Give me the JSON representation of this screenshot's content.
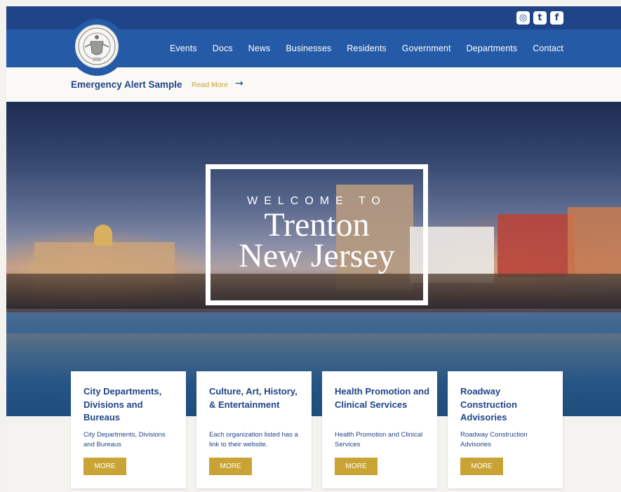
{
  "social": {
    "icons": [
      "instagram-icon",
      "twitter-icon",
      "facebook-icon"
    ],
    "glyphs": [
      "◎",
      "t",
      "f"
    ]
  },
  "nav": {
    "items": [
      "Events",
      "Docs",
      "News",
      "Businesses",
      "Residents",
      "Government",
      "Departments",
      "Contact"
    ]
  },
  "alert": {
    "title": "Emergency Alert Sample",
    "read_more": "Read More",
    "arrow": "→"
  },
  "hero": {
    "welcome": "WELCOME TO",
    "city_line1": "Trenton",
    "city_line2": "New Jersey"
  },
  "cards": [
    {
      "title": "City Departments, Divisions and Bureaus",
      "desc": "City Departments, Divisions and Bureaus",
      "button": "MORE"
    },
    {
      "title": "Culture, Art, History, & Entertainment",
      "desc": "Each organization listed has a link to their website.",
      "button": "MORE"
    },
    {
      "title": "Health Promotion and Clinical Services",
      "desc": "Health Promotion and Clinical Services",
      "button": "MORE"
    },
    {
      "title": "Roadway Construction Advisories",
      "desc": "Roadway Construction Advisories",
      "button": "MORE"
    }
  ],
  "colors": {
    "navy": "#1f4487",
    "blue": "#245aa6",
    "gold": "#c9a434"
  }
}
